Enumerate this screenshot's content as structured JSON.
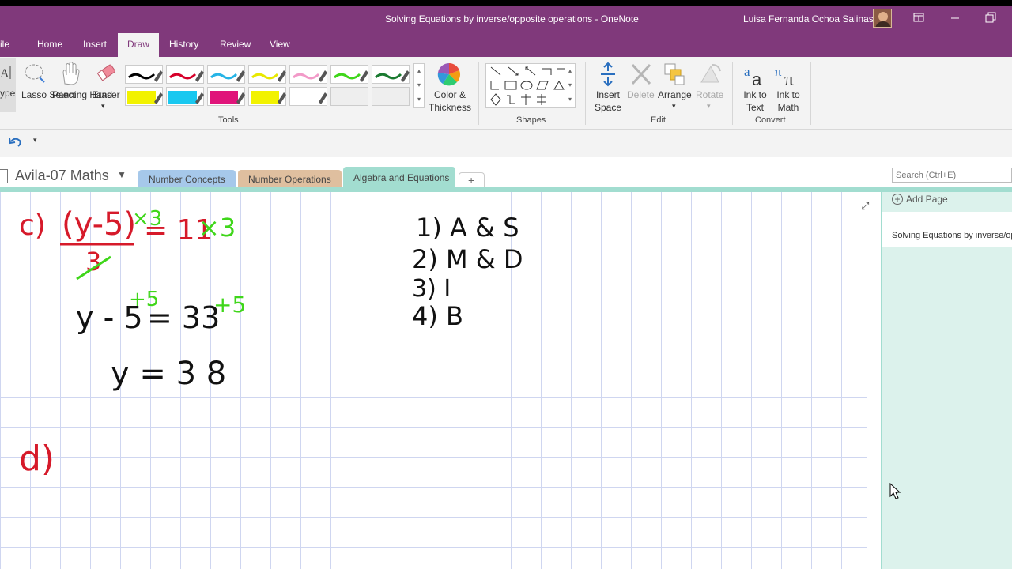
{
  "window": {
    "title": "Solving Equations by inverse/opposite operations  -  OneNote",
    "user": "Luisa Fernanda Ochoa Salinas"
  },
  "ribbon_tabs": [
    "ile",
    "Home",
    "Insert",
    "Draw",
    "History",
    "Review",
    "View"
  ],
  "ribbon": {
    "type_label": "ype",
    "lasso": "Lasso Select",
    "panning": "Panning Hand",
    "eraser": "Eraser",
    "color_thickness": "Color & Thickness",
    "insert_space": "Insert Space",
    "delete": "Delete",
    "arrange": "Arrange",
    "rotate": "Rotate",
    "ink_to_text": "Ink to Text",
    "ink_to_math": "Ink to Math",
    "groups": {
      "tools": "Tools",
      "shapes": "Shapes",
      "edit": "Edit",
      "convert": "Convert"
    },
    "pens": [
      {
        "color": "#000000",
        "kind": "pen"
      },
      {
        "color": "#d6002a",
        "kind": "pen"
      },
      {
        "color": "#26b4e6",
        "kind": "pen"
      },
      {
        "color": "#e8e800",
        "kind": "pen"
      },
      {
        "color": "#f29ac8",
        "kind": "pen"
      },
      {
        "color": "#3fd61a",
        "kind": "pen"
      },
      {
        "color": "#1a7a30",
        "kind": "pen"
      },
      {
        "color": "#f2f200",
        "kind": "highlighter"
      },
      {
        "color": "#19c8f0",
        "kind": "highlighter"
      },
      {
        "color": "#e0147a",
        "kind": "highlighter"
      },
      {
        "color": "#f2f200",
        "kind": "highlighter"
      },
      {
        "color": "#ffffff",
        "kind": "highlighter"
      },
      {
        "color": "#eeeeee",
        "kind": "empty"
      },
      {
        "color": "#eeeeee",
        "kind": "empty"
      }
    ]
  },
  "notebook": {
    "name": "Avila-07 Maths",
    "sections": [
      {
        "label": "Number Concepts",
        "color": "#a6c8ea"
      },
      {
        "label": "Number Operations",
        "color": "#dfbf9f"
      },
      {
        "label": "Algebra and Equations",
        "color": "#a2ddd0"
      }
    ],
    "add_section": "+"
  },
  "search": {
    "placeholder": "Search (Ctrl+E)"
  },
  "pages": {
    "add_page": "Add Page",
    "items": [
      "Solving Equations by inverse/opposite operations"
    ]
  },
  "ink": {
    "c_label": "c)",
    "numerator": "(y-5)",
    "green_mult_top": "×3",
    "denominator": "3",
    "equals_eleven": "= 11",
    "green_mult_right": "×3",
    "line2_left": "y - 5",
    "line2_right": "= 33",
    "green_plus_left": "+5",
    "green_plus_right": "+5",
    "result": "y = 3 8",
    "d_label": "d)",
    "order": [
      "1) A & S",
      "2) M & D",
      "3) I",
      "4) B"
    ]
  }
}
